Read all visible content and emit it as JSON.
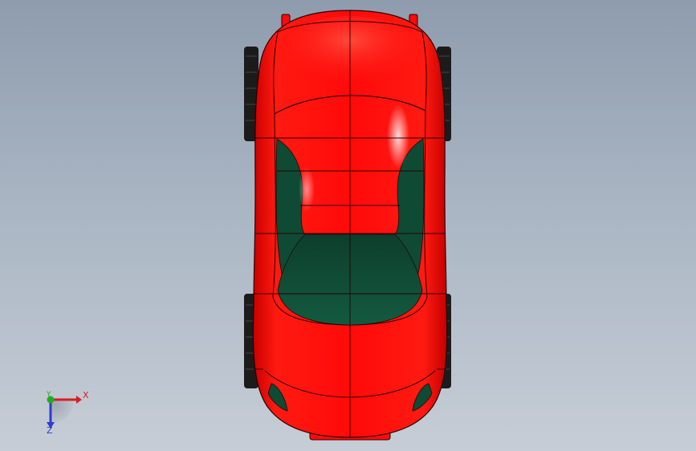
{
  "viewport": {
    "background_top": "#8e9cad",
    "background_bottom": "#c6cdd6"
  },
  "model": {
    "body_color": "#ff0c0c",
    "glass_color": "#0f4a35",
    "tire_color": "#1a1a1a",
    "edge_color": "#2a0000"
  },
  "triad": {
    "x_label": "X",
    "y_label": "Y",
    "z_label": "Z",
    "x_color": "#d81e1e",
    "y_color": "#1fae1f",
    "z_color": "#2a3bd6"
  }
}
